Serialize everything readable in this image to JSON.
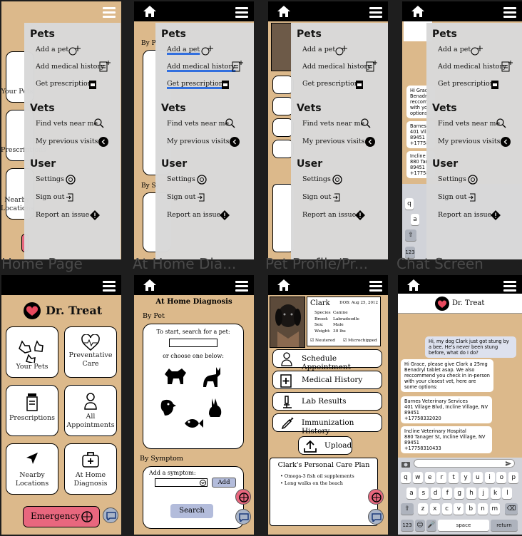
{
  "frames": [
    {
      "label": "Home Page"
    },
    {
      "label": "At Home Dia..."
    },
    {
      "label": "Pet Profile/Pr..."
    },
    {
      "label": "Chat Screen"
    }
  ],
  "menu": {
    "sections": {
      "pets": "Pets",
      "vets": "Vets",
      "user": "User"
    },
    "items": {
      "add_pet": "Add a pet",
      "add_medical": "Add medical history",
      "get_rx": "Get prescription",
      "find_vets": "Find vets near me",
      "previous_visits": "My previous visits",
      "settings": "Settings",
      "sign_out": "Sign out",
      "report": "Report an issue"
    }
  },
  "home": {
    "title": "Dr. Treat",
    "tiles": [
      "Your Pets",
      "Preventative Care",
      "Prescriptions",
      "All Appointments",
      "Nearby Locations",
      "At Home Diagnosis"
    ],
    "emergency": "Emergency"
  },
  "diagnosis": {
    "title": "At Home Diagnosis",
    "by_pet": "By Pet",
    "search_prompt": "To start, search for a pet:",
    "choose_prompt": "or choose one below:",
    "by_symptom": "By Symptom",
    "add_symptom_label": "Add a symptom:",
    "add_button": "Add",
    "search_button": "Search"
  },
  "profile": {
    "name": "Clark",
    "dob": "DOB: Aug 25, 2012",
    "species_label": "Species",
    "species": "Canine",
    "breed_label": "Breed:",
    "breed": "Labradoodle",
    "sex_label": "Sex:",
    "sex": "Male",
    "weight_label": "Weight:",
    "weight": "30 lbs",
    "neutered": "Neutered",
    "microchipped": "Microchipped",
    "buttons": [
      "Schedule Appointment",
      "Medical History",
      "Lab Results",
      "Immunization History"
    ],
    "upload": "Upload",
    "care_plan_title": "Clark's Personal Care Plan",
    "care_plan": [
      "Omega-3 fish oil supplements",
      "Long walks on the beach"
    ]
  },
  "chat": {
    "title": "Dr. Treat",
    "messages": [
      "Hi, my dog Clark just got stung by a bee. He's never been stung before, what do I do?",
      "Hi Grace, please give Clark a 25mg Benadryl tablet asap. We also reccommend you check in in-person with your closest vet, here are some options:",
      "Barnes Veterinary Services\n401 Village Blvd, Incline Village, NV 89451\n+17758332020",
      "Incline Veterinary Hospital\n880 Tanager St, Incline Village, NV 89451\n+17758310433"
    ],
    "keys_row1": [
      "q",
      "w",
      "e",
      "r",
      "t",
      "y",
      "u",
      "i",
      "o",
      "p"
    ],
    "keys_row2": [
      "a",
      "s",
      "d",
      "f",
      "g",
      "h",
      "j",
      "k",
      "l"
    ],
    "keys_row3": [
      "z",
      "x",
      "c",
      "v",
      "b",
      "n",
      "m"
    ],
    "key_123": "123",
    "key_space": "space",
    "key_return": "return"
  }
}
